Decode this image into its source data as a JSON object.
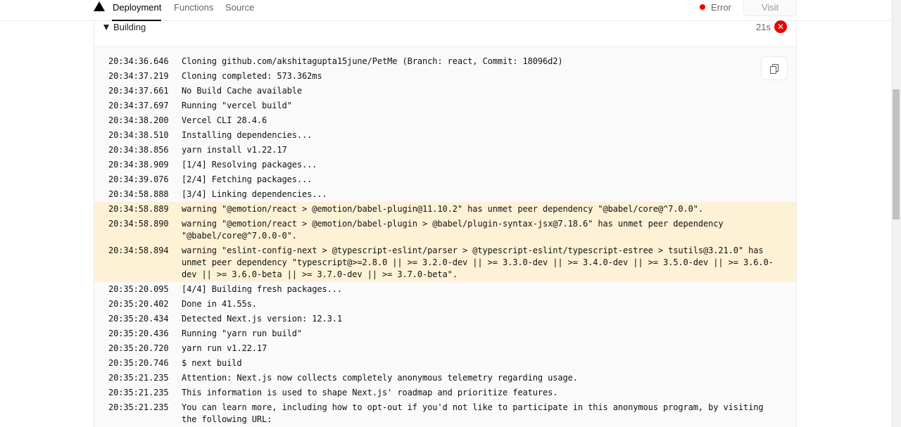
{
  "nav": {
    "tabs": [
      {
        "label": "Deployment"
      },
      {
        "label": "Functions"
      },
      {
        "label": "Source"
      }
    ],
    "status_label": "Error",
    "visit_label": "Visit"
  },
  "build": {
    "title": "Building",
    "duration": "21s",
    "error_symbol": "✕"
  },
  "log_lines": [
    {
      "time": "20:34:36.646",
      "text": "Cloning github.com/akshitagupta15june/PetMe (Branch: react, Commit: 18096d2)"
    },
    {
      "time": "20:34:37.219",
      "text": "Cloning completed: 573.362ms"
    },
    {
      "time": "20:34:37.661",
      "text": "No Build Cache available"
    },
    {
      "time": "20:34:37.697",
      "text": "Running \"vercel build\""
    },
    {
      "time": "20:34:38.200",
      "text": "Vercel CLI 28.4.6"
    },
    {
      "time": "20:34:38.510",
      "text": "Installing dependencies..."
    },
    {
      "time": "20:34:38.856",
      "text": "yarn install v1.22.17"
    },
    {
      "time": "20:34:38.909",
      "text": "[1/4] Resolving packages..."
    },
    {
      "time": "20:34:39.076",
      "text": "[2/4] Fetching packages..."
    },
    {
      "time": "20:34:58.888",
      "text": "[3/4] Linking dependencies..."
    },
    {
      "time": "20:34:58.889",
      "text": "warning \"@emotion/react > @emotion/babel-plugin@11.10.2\" has unmet peer dependency \"@babel/core@^7.0.0\".",
      "warn": true
    },
    {
      "time": "20:34:58.890",
      "text": "warning \"@emotion/react > @emotion/babel-plugin > @babel/plugin-syntax-jsx@7.18.6\" has unmet peer dependency \"@babel/core@^7.0.0-0\".",
      "warn": true
    },
    {
      "time": "20:34:58.894",
      "text": "warning \"eslint-config-next > @typescript-eslint/parser > @typescript-eslint/typescript-estree > tsutils@3.21.0\" has unmet peer dependency \"typescript@>=2.8.0 || >= 3.2.0-dev || >= 3.3.0-dev || >= 3.4.0-dev || >= 3.5.0-dev || >= 3.6.0-dev || >= 3.6.0-beta || >= 3.7.0-dev || >= 3.7.0-beta\".",
      "warn": true
    },
    {
      "time": "20:35:20.095",
      "text": "[4/4] Building fresh packages..."
    },
    {
      "time": "20:35:20.402",
      "text": "Done in 41.55s."
    },
    {
      "time": "20:35:20.434",
      "text": "Detected Next.js version: 12.3.1"
    },
    {
      "time": "20:35:20.436",
      "text": "Running \"yarn run build\""
    },
    {
      "time": "20:35:20.720",
      "text": "yarn run v1.22.17"
    },
    {
      "time": "20:35:20.746",
      "text": "$ next build"
    },
    {
      "time": "20:35:21.235",
      "text": "Attention: Next.js now collects completely anonymous telemetry regarding usage."
    },
    {
      "time": "20:35:21.235",
      "text": "This information is used to shape Next.js' roadmap and prioritize features."
    },
    {
      "time": "20:35:21.235",
      "text": "You can learn more, including how to opt-out if you'd not like to participate in this anonymous program, by visiting the following URL:"
    }
  ]
}
